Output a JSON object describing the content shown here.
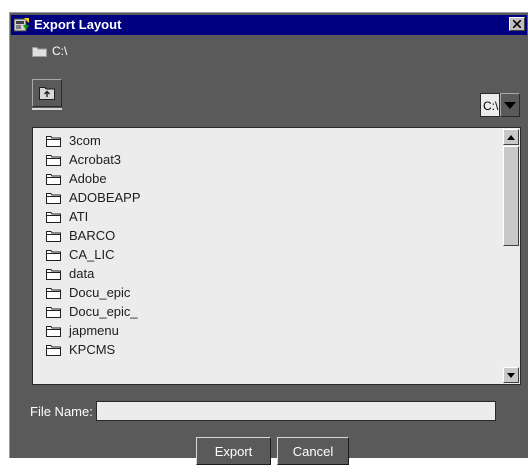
{
  "window": {
    "title": "Export Layout",
    "icons": {
      "app": "export-app-icon",
      "close": "close-icon"
    }
  },
  "current_path": "C:\\",
  "toolbar": {
    "up_icon": "up-folder-icon"
  },
  "drive_select": {
    "value": "C:\\",
    "icon": "chevron-down-icon"
  },
  "folder_list": {
    "items": [
      "3com",
      "Acrobat3",
      "Adobe",
      "ADOBEAPP",
      "ATI",
      "BARCO",
      "CA_LIC",
      "data",
      "Docu_epic",
      "Docu_epic_",
      "japmenu",
      "KPCMS"
    ],
    "item_icon": "folder-icon"
  },
  "file_name": {
    "label": "File Name:",
    "value": ""
  },
  "buttons": {
    "export": "Export",
    "cancel": "Cancel"
  },
  "colors": {
    "dialog_bg": "#5a5a5a",
    "titlebar": "#000080",
    "list_bg": "#ececec"
  }
}
